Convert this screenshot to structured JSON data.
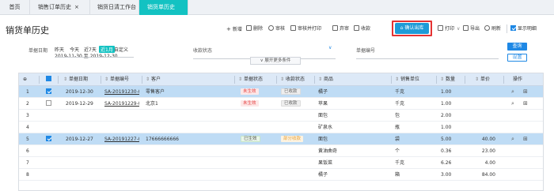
{
  "tabs": [
    {
      "label": "首页",
      "active": false
    },
    {
      "label": "销售订单历史",
      "active": false,
      "closable": true
    },
    {
      "label": "销货日清工作台",
      "active": false,
      "closable": true
    },
    {
      "label": "销货单历史",
      "active": true,
      "closable": true
    }
  ],
  "page_title": "销货单历史",
  "toolbar": {
    "add": "新增",
    "delete": "删除",
    "audit": "审核",
    "audit_print": "审核并打印",
    "abandon": "弃审",
    "collect": "收款",
    "confirm_out": "确认出库",
    "print": "打印",
    "export": "导出",
    "refresh": "刷新",
    "show_detail": "显示明细"
  },
  "filters": {
    "date_label": "单据日期",
    "quick_dates": [
      "昨天",
      "今天",
      "近7天",
      "近1月",
      "自定义"
    ],
    "active_quick_date": "近1月",
    "date_start": "2019-11-30",
    "date_sep": "至",
    "date_end": "2019-12-30",
    "collect_status_label": "收款状态",
    "bill_no_label": "单据编号",
    "expand_label": "展开更多条件",
    "query_button": "查询",
    "settings_button": "设置"
  },
  "grid": {
    "columns": [
      "单据日期",
      "单据编号",
      "客户",
      "单据状态",
      "收款状态",
      "商品",
      "销售单位",
      "数量",
      "单价",
      "操作"
    ],
    "rows": [
      {
        "no": "1",
        "checked": true,
        "selected": true,
        "date": "2019-12-30",
        "bill": "SA-20191230-(",
        "customer": "零售客户",
        "status": "未生效",
        "collect": "已收款",
        "product": "橘子",
        "unit": "千克",
        "qty": "1.00",
        "price": "",
        "ops": true
      },
      {
        "no": "2",
        "checked": false,
        "selected": false,
        "date": "2019-12-29",
        "bill": "SA-20191229-(",
        "customer": "北京1",
        "status": "未生效",
        "collect": "已收款",
        "product": "苹果",
        "unit": "千克",
        "qty": "1.00",
        "price": "",
        "ops": true
      },
      {
        "no": "3",
        "checked": null,
        "selected": false,
        "date": "",
        "bill": "",
        "customer": "",
        "status": "",
        "collect": "",
        "product": "面包",
        "unit": "包",
        "qty": "2.00",
        "price": "",
        "ops": false
      },
      {
        "no": "4",
        "checked": null,
        "selected": false,
        "date": "",
        "bill": "",
        "customer": "",
        "status": "",
        "collect": "",
        "product": "矿泉水",
        "unit": "瓶",
        "qty": "1.00",
        "price": "",
        "ops": false
      },
      {
        "no": "5",
        "checked": true,
        "selected": true,
        "date": "2019-12-27",
        "bill": "SA-20191227-(",
        "customer": "17666666666",
        "status": "已生效",
        "collect": "部分收款",
        "product": "面包",
        "unit": "袋",
        "qty": "5.00",
        "price": "40.00",
        "ops": true
      },
      {
        "no": "6",
        "checked": null,
        "selected": false,
        "date": "",
        "bill": "",
        "customer": "",
        "status": "",
        "collect": "",
        "product": "黄油曲奇",
        "unit": "个",
        "qty": "0.36",
        "price": "23.00",
        "ops": false
      },
      {
        "no": "7",
        "checked": null,
        "selected": false,
        "date": "",
        "bill": "",
        "customer": "",
        "status": "",
        "collect": "",
        "product": "果饭菜",
        "unit": "千克",
        "qty": "6.26",
        "price": "4.00",
        "ops": false
      },
      {
        "no": "8",
        "checked": null,
        "selected": false,
        "date": "",
        "bill": "",
        "customer": "",
        "status": "",
        "collect": "",
        "product": "橘子",
        "unit": "箱",
        "qty": "3.00",
        "price": "84.00",
        "ops": false
      }
    ]
  },
  "colors": {
    "accent": "#13c2c2",
    "primary": "#1e88e5",
    "confirm_button": "#1e9bd7",
    "highlight": "#e53333",
    "selected_row": "#bfdcf5",
    "header_row": "#dde9f7"
  }
}
